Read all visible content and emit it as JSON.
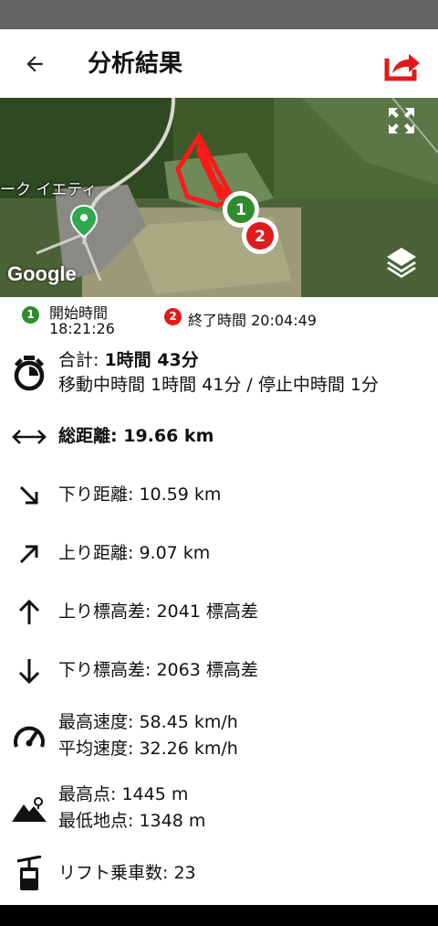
{
  "app": {
    "title": "分析結果"
  },
  "map": {
    "place_label": "ーク イエティ",
    "attribution": "Google",
    "marker_start": "1",
    "marker_end": "2"
  },
  "legend": {
    "start_badge": "1",
    "start_label": "開始時間",
    "start_time": "18:21:26",
    "end_badge": "2",
    "end_text": "終了時間 20:04:49"
  },
  "stats": {
    "total": {
      "label": "合計: ",
      "value": "1時間 43分",
      "detail": "移動中時間 1時間 41分 / 停止中時間 1分"
    },
    "distance": {
      "label": "総距離: ",
      "value": "19.66 km"
    },
    "down_distance": {
      "text": "下り距離: 10.59 km"
    },
    "up_distance": {
      "text": "上り距離: 9.07 km"
    },
    "up_elevation": {
      "text": "上り標高差: 2041 標高差"
    },
    "down_elevation": {
      "text": "下り標高差: 2063 標高差"
    },
    "max_speed": {
      "text": "最高速度: 58.45 km/h"
    },
    "avg_speed": {
      "text": "平均速度: 32.26 km/h"
    },
    "max_point": {
      "text": "最高点: 1445 m"
    },
    "min_point": {
      "text": "最低地点: 1348 m"
    },
    "lift_rides": {
      "text": "リフト乗車数: 23"
    }
  },
  "colors": {
    "accent_red": "#e01b1b",
    "start_green": "#2e8b2e",
    "route_red": "#ff1a1a",
    "statusbar": "#646464"
  },
  "icons": [
    "back-arrow-icon",
    "share-icon",
    "fullscreen-icon",
    "layers-icon",
    "stopwatch-icon",
    "horizontal-arrows-icon",
    "arrow-down-right-icon",
    "arrow-up-right-icon",
    "arrow-up-icon",
    "arrow-down-icon",
    "speedometer-icon",
    "mountain-icon",
    "gondola-icon"
  ]
}
